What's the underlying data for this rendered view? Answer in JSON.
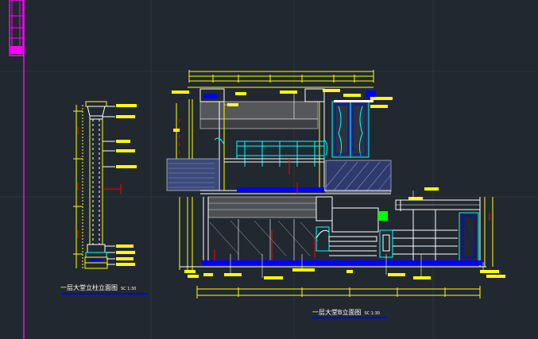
{
  "drawing": {
    "background": "#212830",
    "colors": {
      "yellow": "#ffff00",
      "cyan": "#00ffff",
      "white": "#ffffff",
      "blue": "#0000ff",
      "red": "#ff0000",
      "magenta": "#ff00ff",
      "green": "#00ff00",
      "grid": "#2c343e"
    }
  },
  "views": [
    {
      "id": "column-elevation",
      "title": "一层大堂立柱立面图",
      "scale_label": "SC 1:30"
    },
    {
      "id": "lobby-elevation",
      "title": "一层大堂B立面图",
      "scale_label": "SC 1:30"
    }
  ]
}
